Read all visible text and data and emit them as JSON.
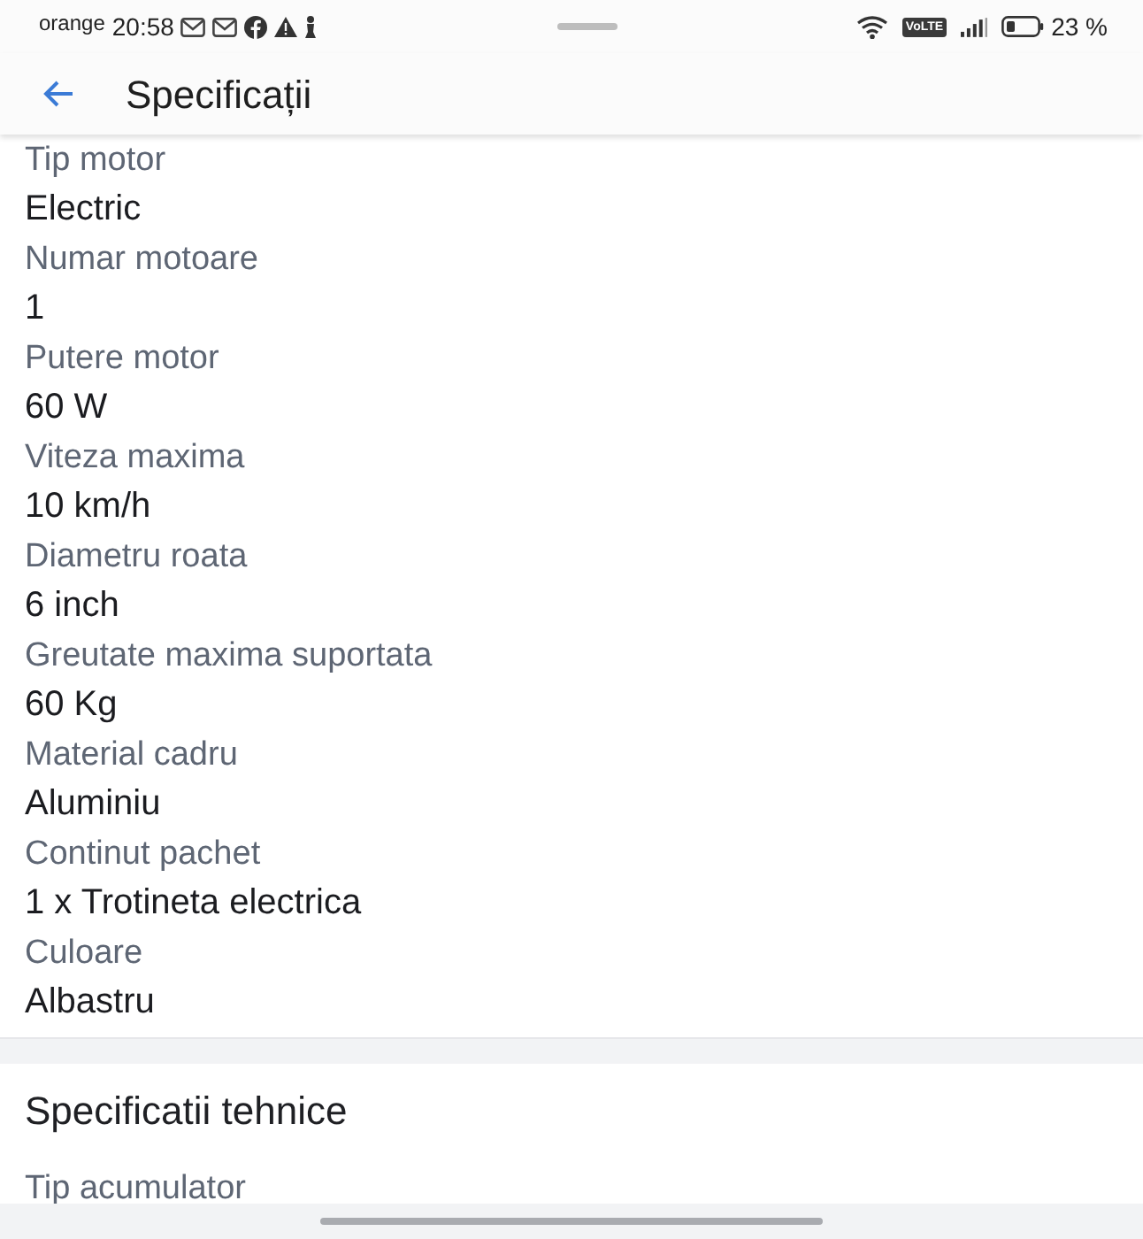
{
  "status_bar": {
    "carrier": "orange",
    "time": "20:58",
    "volte": "VoLTE",
    "battery": "23 %"
  },
  "header": {
    "title": "Specificații"
  },
  "specs": [
    {
      "label": "Tip motor",
      "value": "Electric"
    },
    {
      "label": "Numar motoare",
      "value": "1"
    },
    {
      "label": "Putere motor",
      "value": "60 W"
    },
    {
      "label": "Viteza maxima",
      "value": "10 km/h"
    },
    {
      "label": "Diametru roata",
      "value": "6 inch"
    },
    {
      "label": "Greutate maxima suportata",
      "value": "60 Kg"
    },
    {
      "label": "Material cadru",
      "value": "Aluminiu"
    },
    {
      "label": "Continut pachet",
      "value": "1 x Trotineta electrica"
    },
    {
      "label": "Culoare",
      "value": "Albastru"
    }
  ],
  "section": {
    "title": "Specificatii tehnice",
    "specs": [
      {
        "label": "Tip acumulator"
      }
    ]
  }
}
